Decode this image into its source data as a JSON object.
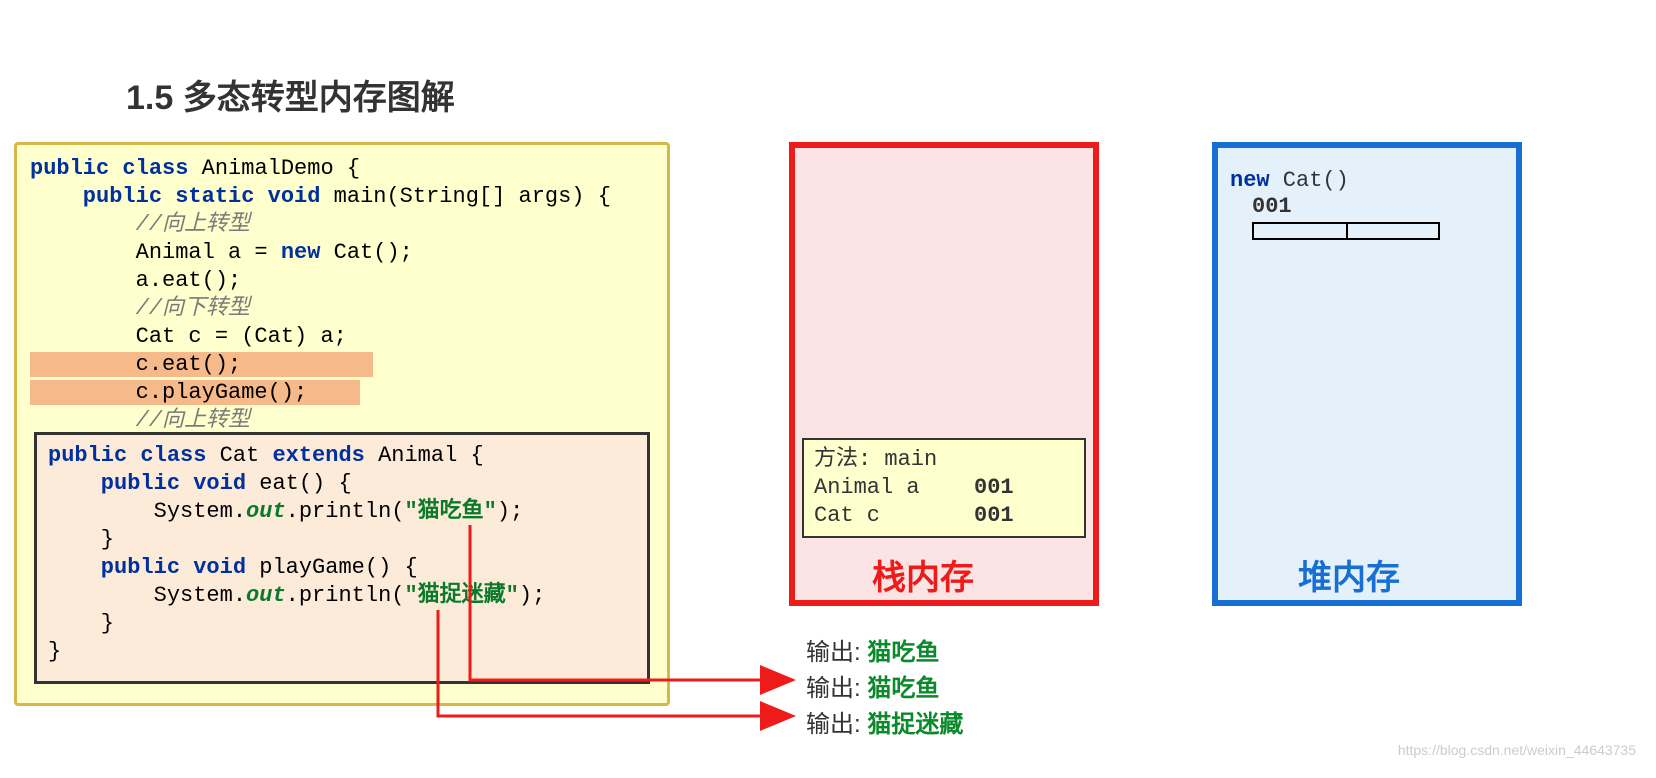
{
  "title": "1.5 多态转型内存图解",
  "code1": {
    "l1a": "public",
    "l1b": " class",
    "l1c": " AnimalDemo {",
    "l2a": "    public",
    "l2b": " static",
    "l2c": " void",
    "l2d": " main(String[] args) {",
    "l3": "        //向上转型",
    "l4a": "        Animal a = ",
    "l4b": "new",
    "l4c": " Cat();",
    "l5": "        a.eat();",
    "l6": "        //向下转型",
    "l7": "        Cat c = (Cat) a;",
    "l8": "        c.eat();",
    "l9": "        c.playGame();",
    "l10": "        //向上转型"
  },
  "code2": {
    "l1a": "public",
    "l1b": " class",
    "l1c": " Cat ",
    "l1d": "extends",
    "l1e": " Animal {",
    "l2a": "    public",
    "l2b": " void",
    "l2c": " eat() {",
    "l3a": "        System.",
    "l3b": "out",
    "l3c": ".println(",
    "l3d": "\"猫吃鱼\"",
    "l3e": ");",
    "l4": "    }",
    "l5a": "    public",
    "l5b": " void",
    "l5c": " playGame() {",
    "l6a": "        System.",
    "l6b": "out",
    "l6c": ".println(",
    "l6d": "\"猫捉迷藏\"",
    "l6e": ");",
    "l7": "    }",
    "l8": "}"
  },
  "stack": {
    "title": "方法: main",
    "r1l": "Animal a",
    "r1r": "001",
    "r2l": "Cat c",
    "r2r": "001",
    "label": "栈内存"
  },
  "heap": {
    "new_kw": "new",
    "new_txt": " Cat()",
    "addr": "001",
    "label": "堆内存"
  },
  "output": {
    "prefix": "输出: ",
    "v1": "猫吃鱼",
    "v2": "猫吃鱼",
    "v3": "猫捉迷藏"
  },
  "watermark": "https://blog.csdn.net/weixin_44643735"
}
